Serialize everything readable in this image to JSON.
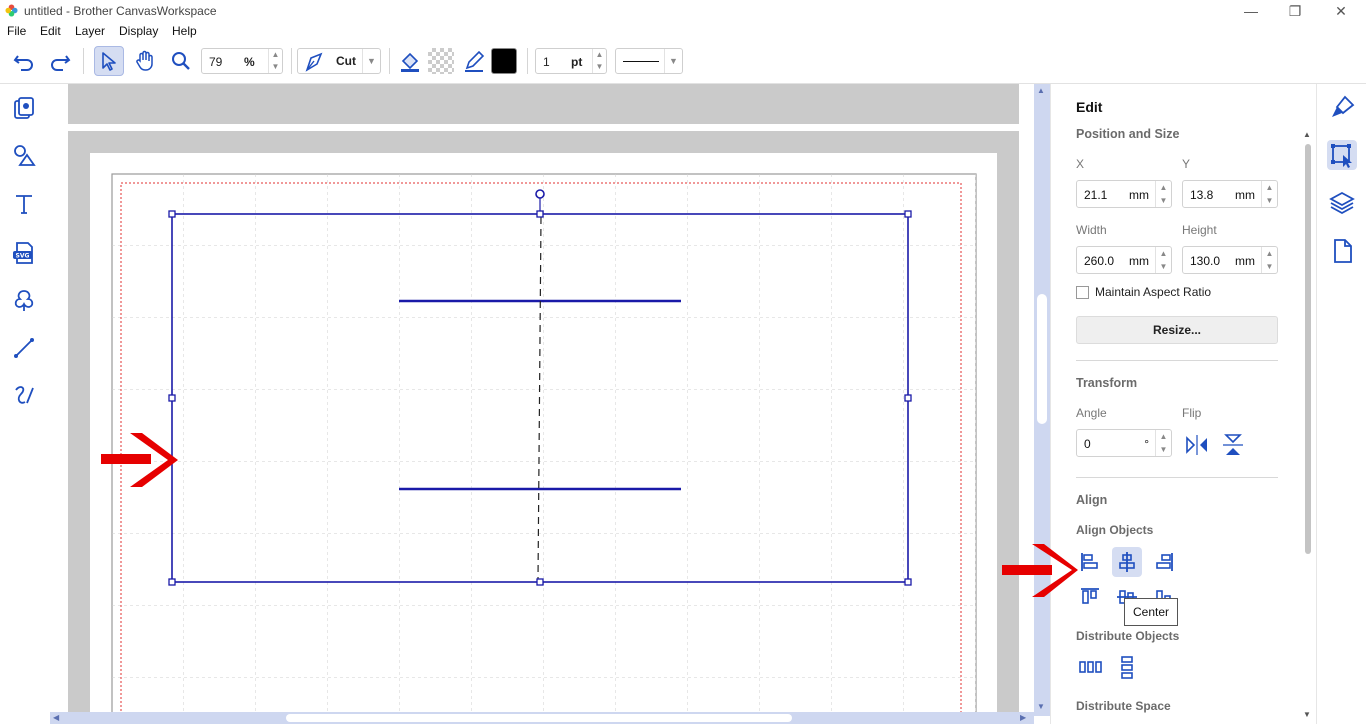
{
  "window": {
    "title": "untitled - Brother CanvasWorkspace",
    "controls": [
      "minimize",
      "restore",
      "close"
    ]
  },
  "menu": {
    "items": [
      "File",
      "Edit",
      "Layer",
      "Display",
      "Help"
    ]
  },
  "toolbar": {
    "zoom_value": "79",
    "zoom_unit": "%",
    "mode_label": "Cut",
    "line_width_value": "1",
    "line_width_unit": "pt",
    "stroke_color": "#000000",
    "icons": [
      "undo-icon",
      "redo-icon",
      "select-arrow-icon",
      "hand-pan-icon",
      "zoom-icon",
      "cut-pen-icon",
      "fill-bucket-icon",
      "transparent-fill-icon",
      "line-pen-icon",
      "line-style-icon"
    ]
  },
  "left_tools": [
    "pattern-icon",
    "shapes-icon",
    "text-icon",
    "svg-import-icon",
    "trace-icon",
    "line-tool-icon",
    "freehand-icon"
  ],
  "panel": {
    "heading": "Edit",
    "position_size": {
      "title": "Position and Size",
      "x_label": "X",
      "x_value": "21.1",
      "y_label": "Y",
      "y_value": "13.8",
      "width_label": "Width",
      "width_value": "260.0",
      "height_label": "Height",
      "height_value": "130.0",
      "unit": "mm",
      "maintain_aspect_label": "Maintain Aspect Ratio",
      "maintain_aspect_checked": false,
      "resize_label": "Resize..."
    },
    "transform": {
      "title": "Transform",
      "angle_label": "Angle",
      "angle_value": "0",
      "angle_unit": "°",
      "flip_label": "Flip"
    },
    "align": {
      "title": "Align",
      "align_objects_label": "Align Objects",
      "tooltip": "Center",
      "distribute_objects_label": "Distribute Objects",
      "distribute_space_label": "Distribute Space"
    }
  },
  "right_strip": [
    "brush-icon",
    "select-transform-icon",
    "layers-icon",
    "page-icon"
  ],
  "colors": {
    "accent": "#1f4fbf",
    "selection": "#1a1aa8",
    "annotation_arrow": "#e60000",
    "cut_border": "#e03030"
  }
}
